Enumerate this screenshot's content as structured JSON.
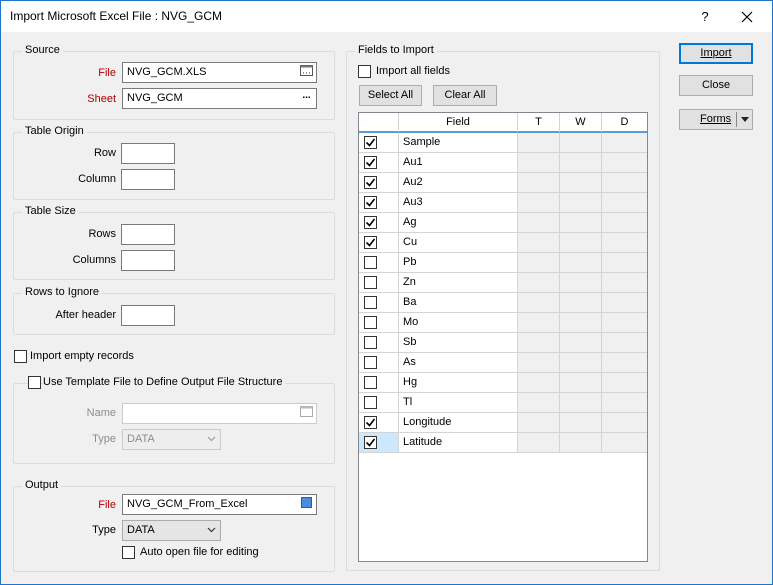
{
  "window": {
    "title": "Import Microsoft Excel File : NVG_GCM",
    "help": "?"
  },
  "source": {
    "title": "Source",
    "file_label": "File",
    "file_value": "NVG_GCM.XLS",
    "sheet_label": "Sheet",
    "sheet_value": "NVG_GCM",
    "sheet_button": "..."
  },
  "table_origin": {
    "title": "Table Origin",
    "row_label": "Row",
    "row_value": "",
    "column_label": "Column",
    "column_value": ""
  },
  "table_size": {
    "title": "Table Size",
    "rows_label": "Rows",
    "rows_value": "",
    "columns_label": "Columns",
    "columns_value": ""
  },
  "rows_to_ignore": {
    "title": "Rows to Ignore",
    "after_header_label": "After header",
    "after_header_value": ""
  },
  "import_empty": {
    "label": "Import empty records",
    "checked": false
  },
  "template": {
    "title": "Use Template File to Define Output File Structure",
    "checked": false,
    "name_label": "Name",
    "name_value": "",
    "type_label": "Type",
    "type_value": "DATA"
  },
  "output": {
    "title": "Output",
    "file_label": "File",
    "file_value": "NVG_GCM_From_Excel",
    "type_label": "Type",
    "type_value": "DATA",
    "auto_open_label": "Auto open file for editing",
    "auto_open_checked": false
  },
  "fields": {
    "title": "Fields to Import",
    "import_all_label": "Import all fields",
    "import_all_checked": false,
    "select_all": "Select All",
    "clear_all": "Clear All",
    "columns": [
      "",
      "Field",
      "T",
      "W",
      "D"
    ],
    "rows": [
      {
        "name": "Sample",
        "checked": true
      },
      {
        "name": "Au1",
        "checked": true
      },
      {
        "name": "Au2",
        "checked": true
      },
      {
        "name": "Au3",
        "checked": true
      },
      {
        "name": "Ag",
        "checked": true
      },
      {
        "name": "Cu",
        "checked": true
      },
      {
        "name": "Pb",
        "checked": false
      },
      {
        "name": "Zn",
        "checked": false
      },
      {
        "name": "Ba",
        "checked": false
      },
      {
        "name": "Mo",
        "checked": false
      },
      {
        "name": "Sb",
        "checked": false
      },
      {
        "name": "As",
        "checked": false
      },
      {
        "name": "Hg",
        "checked": false
      },
      {
        "name": "Tl",
        "checked": false
      },
      {
        "name": "Longitude",
        "checked": true
      },
      {
        "name": "Latitude",
        "checked": true
      }
    ]
  },
  "buttons": {
    "import": "Import",
    "close": "Close",
    "forms": "Forms"
  },
  "colors": {
    "accent": "#0078d7",
    "label_red": "#b00000",
    "selection": "#cce8ff",
    "header_line": "#5b9bd5"
  }
}
